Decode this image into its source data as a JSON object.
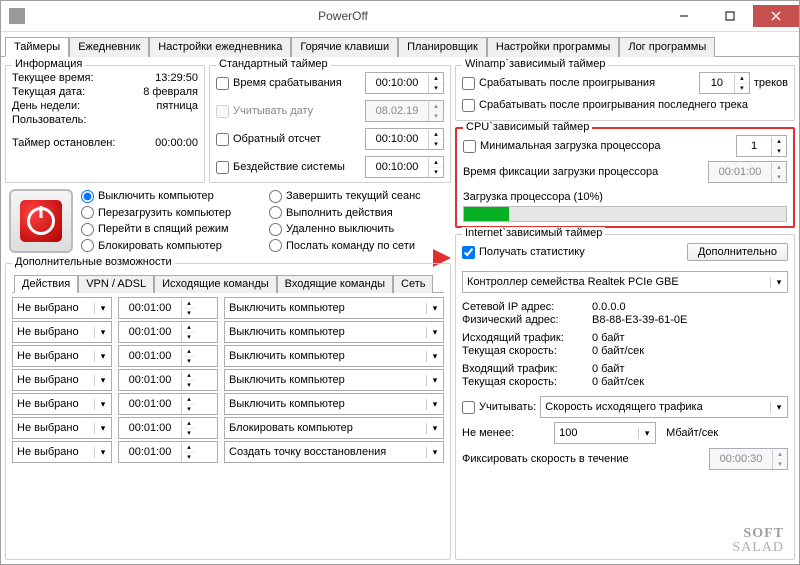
{
  "window": {
    "title": "PowerOff"
  },
  "tabs": [
    "Таймеры",
    "Ежедневник",
    "Настройки ежедневника",
    "Горячие клавиши",
    "Планировщик",
    "Настройки программы",
    "Лог программы"
  ],
  "info": {
    "legend": "Информация",
    "rows": [
      {
        "k": "Текущее время:",
        "v": "13:29:50"
      },
      {
        "k": "Текущая дата:",
        "v": "8 февраля"
      },
      {
        "k": "День недели:",
        "v": "пятница"
      },
      {
        "k": "Пользователь:",
        "v": ""
      }
    ],
    "timer_k": "Таймер остановлен:",
    "timer_v": "00:00:00"
  },
  "std": {
    "legend": "Стандартный таймер",
    "rows": [
      {
        "label": "Время срабатывания",
        "val": "00:10:00",
        "checked": false,
        "disabled": false
      },
      {
        "label": "Учитывать дату",
        "val": "08.02.19",
        "checked": false,
        "disabled": true
      },
      {
        "label": "Обратный отсчет",
        "val": "00:10:00",
        "checked": false,
        "disabled": false
      },
      {
        "label": "Бездействие системы",
        "val": "00:10:00",
        "checked": false,
        "disabled": false
      }
    ]
  },
  "actions": {
    "radios": [
      "Выключить компьютер",
      "Завершить текущий сеанс",
      "Перезагрузить компьютер",
      "Выполнить действия",
      "Перейти в спящий режим",
      "Удаленно выключить",
      "Блокировать компьютер",
      "Послать команду по сети"
    ],
    "checked": 0
  },
  "extra": {
    "legend": "Дополнительные возможности",
    "subtabs": [
      "Действия",
      "VPN / ADSL",
      "Исходящие команды",
      "Входящие команды",
      "Сеть"
    ],
    "rows": [
      {
        "a": "Не выбрано",
        "t": "00:01:00",
        "b": "Выключить компьютер"
      },
      {
        "a": "Не выбрано",
        "t": "00:01:00",
        "b": "Выключить компьютер"
      },
      {
        "a": "Не выбрано",
        "t": "00:01:00",
        "b": "Выключить компьютер"
      },
      {
        "a": "Не выбрано",
        "t": "00:01:00",
        "b": "Выключить компьютер"
      },
      {
        "a": "Не выбрано",
        "t": "00:01:00",
        "b": "Выключить компьютер"
      },
      {
        "a": "Не выбрано",
        "t": "00:01:00",
        "b": "Блокировать компьютер"
      },
      {
        "a": "Не выбрано",
        "t": "00:01:00",
        "b": "Создать точку восстановления"
      }
    ]
  },
  "winamp": {
    "legend": "Winamp`зависимый таймер",
    "row1_label": "Срабатывать после проигрывания",
    "row1_val": "10",
    "row1_unit": "треков",
    "row2_label": "Срабатывать после проигрывания последнего трека"
  },
  "cpu": {
    "legend": "CPU`зависимый таймер",
    "row1_label": "Минимальная загрузка процессора",
    "row1_val": "1",
    "row2_label": "Время фиксации загрузки процессора",
    "row2_val": "00:01:00",
    "row3_label": "Загрузка процессора (10%)",
    "progress_pct": 14
  },
  "net": {
    "legend": "Internet`зависимый таймер",
    "stats_label": "Получать статистику",
    "stats_checked": true,
    "more_btn": "Дополнительно",
    "adapter": "Контроллер семейства Realtek PCIe GBE",
    "kv": [
      {
        "k": "Сетевой IP адрес:",
        "v": "0.0.0.0"
      },
      {
        "k": "Физический адрес:",
        "v": "B8-88-E3-39-61-0E"
      },
      {
        "k": "Исходящий трафик:",
        "v": "0 байт"
      },
      {
        "k": "Текущая скорость:",
        "v": "0 байт/сек"
      },
      {
        "k": "Входящий трафик:",
        "v": "0 байт"
      },
      {
        "k": "Текущая скорость:",
        "v": "0 байт/сек"
      }
    ],
    "consider_label": "Учитывать:",
    "consider_val": "Скорость исходящего трафика",
    "min_label": "Не менее:",
    "min_val": "100",
    "min_unit": "Мбайт/сек",
    "fix_label": "Фиксировать скорость в течение",
    "fix_val": "00:00:30"
  },
  "watermark": {
    "l1": "SOFT",
    "l2": "SALAD"
  }
}
